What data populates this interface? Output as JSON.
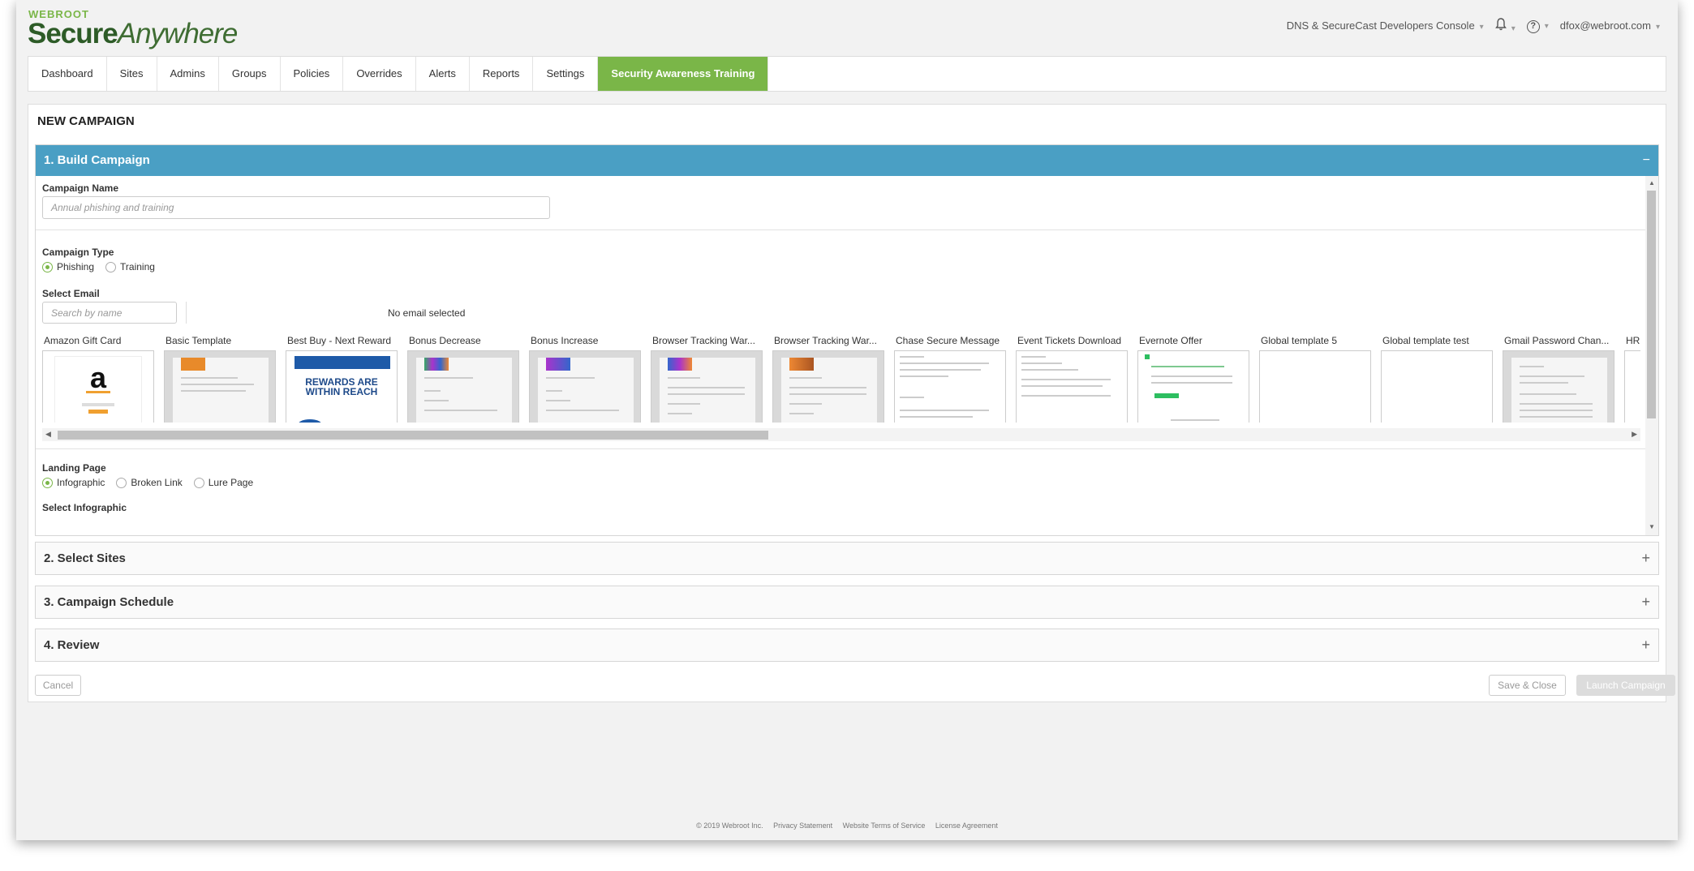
{
  "brand": {
    "small": "WEBROOT",
    "main_bold": "Secure",
    "main_light": "Anywhere"
  },
  "header": {
    "console": "DNS & SecureCast Developers Console",
    "user": "dfox@webroot.com",
    "help": "?"
  },
  "tabs": [
    {
      "label": "Dashboard"
    },
    {
      "label": "Sites"
    },
    {
      "label": "Admins"
    },
    {
      "label": "Groups"
    },
    {
      "label": "Policies"
    },
    {
      "label": "Overrides"
    },
    {
      "label": "Alerts"
    },
    {
      "label": "Reports"
    },
    {
      "label": "Settings"
    },
    {
      "label": "Security Awareness Training",
      "active": true
    }
  ],
  "page_title": "NEW CAMPAIGN",
  "build": {
    "header": "1. Build Campaign",
    "collapse": "−",
    "name_label": "Campaign Name",
    "name_placeholder": "Annual phishing and training",
    "type_label": "Campaign Type",
    "type_options": [
      "Phishing",
      "Training"
    ],
    "select_email_label": "Select Email",
    "search_placeholder": "Search by name",
    "no_email": "No email selected",
    "emails": [
      {
        "name": "Amazon Gift Card"
      },
      {
        "name": "Basic Template"
      },
      {
        "name": "Best Buy - Next Reward",
        "banner": "REWARDS ARE WITHIN REACH"
      },
      {
        "name": "Bonus Decrease"
      },
      {
        "name": "Bonus Increase"
      },
      {
        "name": "Browser Tracking War..."
      },
      {
        "name": "Browser Tracking War..."
      },
      {
        "name": "Chase Secure Message"
      },
      {
        "name": "Event Tickets Download"
      },
      {
        "name": "Evernote Offer"
      },
      {
        "name": "Global template 5"
      },
      {
        "name": "Global template test"
      },
      {
        "name": "Gmail Password Chan..."
      },
      {
        "name": "HR"
      }
    ],
    "amazon_logo": "a",
    "landing_label": "Landing Page",
    "landing_options": [
      "Infographic",
      "Broken Link",
      "Lure Page"
    ],
    "select_infographic_label": "Select Infographic"
  },
  "sections": [
    {
      "label": "2. Select Sites"
    },
    {
      "label": "3. Campaign Schedule"
    },
    {
      "label": "4. Review"
    }
  ],
  "expand": "+",
  "buttons": {
    "cancel": "Cancel",
    "save": "Save & Close",
    "launch": "Launch Campaign"
  },
  "footer": {
    "copyright": "© 2019 Webroot Inc.",
    "privacy": "Privacy Statement",
    "terms": "Website Terms of Service",
    "license": "License Agreement"
  },
  "colors": {
    "brand_green": "#7ab648",
    "panel_blue": "#4a9fc4",
    "logo_dark": "#2d5b27"
  }
}
